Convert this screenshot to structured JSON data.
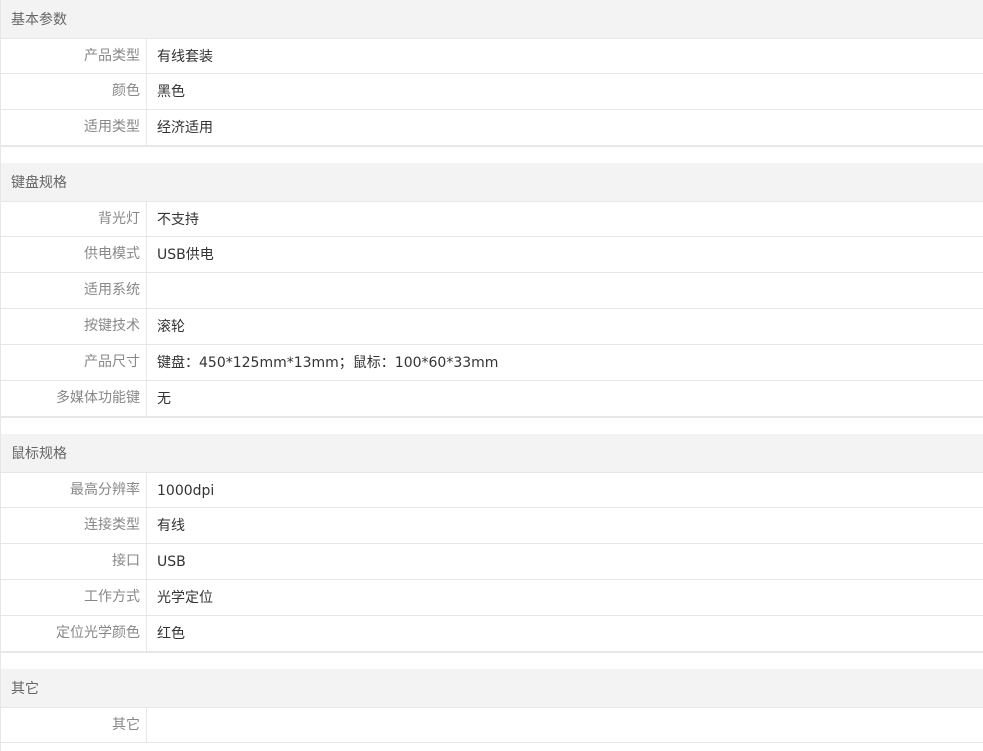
{
  "sections": [
    {
      "title": "基本参数",
      "rows": [
        {
          "label": "产品类型",
          "value": "有线套装"
        },
        {
          "label": "颜色",
          "value": "黑色"
        },
        {
          "label": "适用类型",
          "value": "经济适用"
        }
      ]
    },
    {
      "title": "键盘规格",
      "rows": [
        {
          "label": "背光灯",
          "value": "不支持"
        },
        {
          "label": "供电模式",
          "value": "USB供电"
        },
        {
          "label": "适用系统",
          "value": ""
        },
        {
          "label": "按键技术",
          "value": "滚轮"
        },
        {
          "label": "产品尺寸",
          "value": "键盘：450*125mm*13mm；鼠标：100*60*33mm"
        },
        {
          "label": "多媒体功能键",
          "value": "无"
        }
      ]
    },
    {
      "title": "鼠标规格",
      "rows": [
        {
          "label": "最高分辨率",
          "value": "1000dpi"
        },
        {
          "label": "连接类型",
          "value": "有线"
        },
        {
          "label": "接口",
          "value": "USB"
        },
        {
          "label": "工作方式",
          "value": "光学定位"
        },
        {
          "label": "定位光学颜色",
          "value": "红色"
        }
      ]
    },
    {
      "title": "其它",
      "rows": [
        {
          "label": "其它",
          "value": ""
        }
      ]
    }
  ]
}
